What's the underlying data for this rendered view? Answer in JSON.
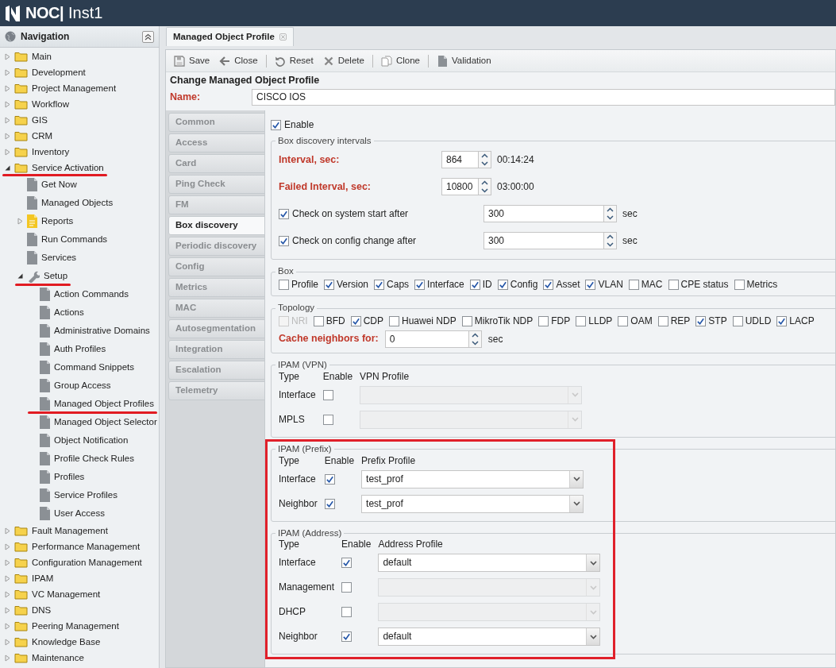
{
  "app": {
    "logo": "NOC|",
    "instance": "Inst1"
  },
  "navigation": {
    "title": "Navigation",
    "items": [
      {
        "label": "Main",
        "kind": "folder",
        "expanded": false
      },
      {
        "label": "Development",
        "kind": "folder",
        "expanded": false
      },
      {
        "label": "Project Management",
        "kind": "folder",
        "expanded": false
      },
      {
        "label": "Workflow",
        "kind": "folder",
        "expanded": false
      },
      {
        "label": "GIS",
        "kind": "folder",
        "expanded": false
      },
      {
        "label": "CRM",
        "kind": "folder",
        "expanded": false
      },
      {
        "label": "Inventory",
        "kind": "folder",
        "expanded": false
      },
      {
        "label": "Service Activation",
        "kind": "folder",
        "expanded": true,
        "underlined": true,
        "children": [
          {
            "label": "Get Now",
            "kind": "document"
          },
          {
            "label": "Managed Objects",
            "kind": "document"
          },
          {
            "label": "Reports",
            "kind": "report",
            "expanded": false
          },
          {
            "label": "Run Commands",
            "kind": "document"
          },
          {
            "label": "Services",
            "kind": "document"
          },
          {
            "label": "Setup",
            "kind": "wrench",
            "expanded": true,
            "underlined": true,
            "children": [
              {
                "label": "Action Commands",
                "kind": "document"
              },
              {
                "label": "Actions",
                "kind": "document"
              },
              {
                "label": "Administrative Domains",
                "kind": "document"
              },
              {
                "label": "Auth Profiles",
                "kind": "document"
              },
              {
                "label": "Command Snippets",
                "kind": "document"
              },
              {
                "label": "Group Access",
                "kind": "document"
              },
              {
                "label": "Managed Object Profiles",
                "kind": "document",
                "underlined": true
              },
              {
                "label": "Managed Object Selector",
                "kind": "document"
              },
              {
                "label": "Object Notification",
                "kind": "document"
              },
              {
                "label": "Profile Check Rules",
                "kind": "document"
              },
              {
                "label": "Profiles",
                "kind": "document"
              },
              {
                "label": "Service Profiles",
                "kind": "document"
              },
              {
                "label": "User Access",
                "kind": "document"
              }
            ]
          }
        ]
      },
      {
        "label": "Fault Management",
        "kind": "folder",
        "expanded": false
      },
      {
        "label": "Performance Management",
        "kind": "folder",
        "expanded": false
      },
      {
        "label": "Configuration Management",
        "kind": "folder",
        "expanded": false
      },
      {
        "label": "IPAM",
        "kind": "folder",
        "expanded": false
      },
      {
        "label": "VC Management",
        "kind": "folder",
        "expanded": false
      },
      {
        "label": "DNS",
        "kind": "folder",
        "expanded": false
      },
      {
        "label": "Peering Management",
        "kind": "folder",
        "expanded": false
      },
      {
        "label": "Knowledge Base",
        "kind": "folder",
        "expanded": false
      },
      {
        "label": "Maintenance",
        "kind": "folder",
        "expanded": false
      }
    ]
  },
  "tabs": [
    {
      "label": "Managed Object Profile",
      "selected": true
    }
  ],
  "toolbar": [
    {
      "label": "Save",
      "kind": "save"
    },
    {
      "label": "Close",
      "kind": "close",
      "separator_after": true
    },
    {
      "label": "Reset",
      "kind": "reset"
    },
    {
      "label": "Delete",
      "kind": "delete",
      "separator_after": true
    },
    {
      "label": "Clone",
      "kind": "clone",
      "separator_after": true
    },
    {
      "label": "Validation",
      "kind": "validation"
    }
  ],
  "form": {
    "title": "Change Managed Object Profile",
    "name_label": "Name:",
    "name_value": "CISCO IOS",
    "side_tabs": [
      {
        "label": "Common",
        "selected": false
      },
      {
        "label": "Access",
        "selected": false
      },
      {
        "label": "Card",
        "selected": false
      },
      {
        "label": "Ping Check",
        "selected": false
      },
      {
        "label": "FM",
        "selected": false
      },
      {
        "label": "Box discovery",
        "selected": true
      },
      {
        "label": "Periodic discovery",
        "selected": false
      },
      {
        "label": "Config",
        "selected": false
      },
      {
        "label": "Metrics",
        "selected": false
      },
      {
        "label": "MAC",
        "selected": false
      },
      {
        "label": "Autosegmentation",
        "selected": false
      },
      {
        "label": "Integration",
        "selected": false
      },
      {
        "label": "Escalation",
        "selected": false
      },
      {
        "label": "Telemetry",
        "selected": false
      }
    ],
    "enable": {
      "label": "Enable",
      "checked": true
    },
    "intervals": {
      "title": "Box discovery intervals",
      "rows": [
        {
          "kind": "required",
          "label": "Interval, sec:",
          "value": "864",
          "reading": "00:14:24"
        },
        {
          "kind": "required",
          "label": "Failed Interval, sec:",
          "value": "10800",
          "reading": "03:00:00"
        },
        {
          "kind": "check",
          "label": "Check on system start after",
          "checked": true,
          "value": "300",
          "unit": "sec"
        },
        {
          "kind": "check",
          "label": "Check on config change after",
          "checked": true,
          "value": "300",
          "unit": "sec"
        }
      ]
    },
    "box": {
      "title": "Box",
      "options": [
        {
          "label": "Profile",
          "checked": false
        },
        {
          "label": "Version",
          "checked": true
        },
        {
          "label": "Caps",
          "checked": true
        },
        {
          "label": "Interface",
          "checked": true
        },
        {
          "label": "ID",
          "checked": true
        },
        {
          "label": "Config",
          "checked": true
        },
        {
          "label": "Asset",
          "checked": true
        },
        {
          "label": "VLAN",
          "checked": true
        },
        {
          "label": "MAC",
          "checked": false
        },
        {
          "label": "CPE status",
          "checked": false
        },
        {
          "label": "Metrics",
          "checked": false
        }
      ]
    },
    "topology": {
      "title": "Topology",
      "options": [
        {
          "label": "NRI",
          "checked": false,
          "disabled": true
        },
        {
          "label": "BFD",
          "checked": false
        },
        {
          "label": "CDP",
          "checked": true
        },
        {
          "label": "Huawei NDP",
          "checked": false
        },
        {
          "label": "MikroTik NDP",
          "checked": false
        },
        {
          "label": "FDP",
          "checked": false
        },
        {
          "label": "LLDP",
          "checked": false
        },
        {
          "label": "OAM",
          "checked": false
        },
        {
          "label": "REP",
          "checked": false
        },
        {
          "label": "STP",
          "checked": true
        },
        {
          "label": "UDLD",
          "checked": false
        },
        {
          "label": "LACP",
          "checked": true
        }
      ],
      "cache_label": "Cache neighbors for:",
      "cache_value": "0",
      "cache_unit": "sec"
    },
    "ipam": [
      {
        "title": "IPAM (VPN)",
        "highlighted": false,
        "columns": [
          "Type",
          "Enable",
          "VPN Profile"
        ],
        "rows": [
          {
            "type": "Interface",
            "enabled": false
          },
          {
            "type": "MPLS",
            "enabled": false
          }
        ]
      },
      {
        "title": "IPAM (Prefix)",
        "highlighted": true,
        "columns": [
          "Type",
          "Enable",
          "Prefix Profile"
        ],
        "rows": [
          {
            "type": "Interface",
            "enabled": true,
            "profile": "test_prof"
          },
          {
            "type": "Neighbor",
            "enabled": true,
            "profile": "test_prof"
          }
        ]
      },
      {
        "title": "IPAM (Address)",
        "highlighted": true,
        "columns": [
          "Type",
          "Enable",
          "Address Profile"
        ],
        "rows": [
          {
            "type": "Interface",
            "enabled": true,
            "profile": "default"
          },
          {
            "type": "Management",
            "enabled": false
          },
          {
            "type": "DHCP",
            "enabled": false
          },
          {
            "type": "Neighbor",
            "enabled": true,
            "profile": "default"
          }
        ]
      }
    ]
  }
}
